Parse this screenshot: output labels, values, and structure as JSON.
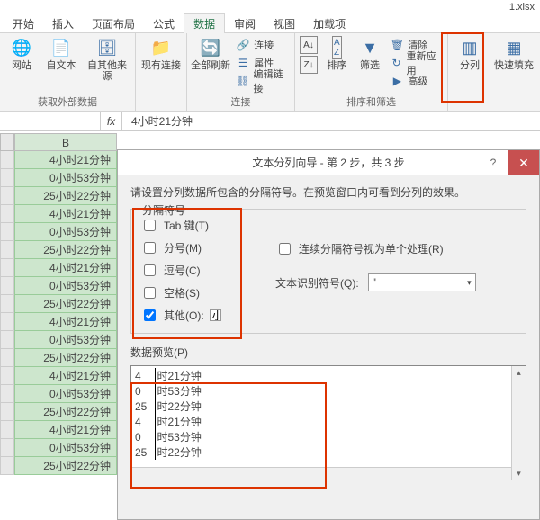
{
  "file_name": "1.xlsx",
  "tabs": {
    "t0": "开始",
    "t1": "插入",
    "t2": "页面布局",
    "t3": "公式",
    "t4": "数据",
    "t5": "审阅",
    "t6": "视图",
    "t7": "加载项"
  },
  "ribbon": {
    "ext_data_group": "获取外部数据",
    "web": "网站",
    "text": "自文本",
    "other": "自其他来源",
    "existing": "现有连接",
    "refresh": "全部刷新",
    "connections": "连接",
    "properties": "属性",
    "editlinks": "编辑链接",
    "conn_group": "连接",
    "sort": "排序",
    "filter": "筛选",
    "clear": "清除",
    "reapply": "重新应用",
    "advanced": "高级",
    "sort_group": "排序和筛选",
    "texttocol": "分列",
    "flashfill": "快速填充"
  },
  "formula_bar": {
    "fx": "fx",
    "value": "4小时21分钟"
  },
  "column_header": "B",
  "cells": [
    "4小时21分钟",
    "0小时53分钟",
    "25小时22分钟",
    "4小时21分钟",
    "0小时53分钟",
    "25小时22分钟",
    "4小时21分钟",
    "0小时53分钟",
    "25小时22分钟",
    "4小时21分钟",
    "0小时53分钟",
    "25小时22分钟",
    "4小时21分钟",
    "0小时53分钟",
    "25小时22分钟",
    "4小时21分钟",
    "0小时53分钟",
    "25小时22分钟"
  ],
  "dialog": {
    "title": "文本分列向导 - 第 2 步，共 3 步",
    "desc": "请设置分列数据所包含的分隔符号。在预览窗口内可看到分列的效果。",
    "legend": "分隔符号",
    "tab": "Tab 键(T)",
    "semicolon": "分号(M)",
    "comma": "逗号(C)",
    "space": "空格(S)",
    "other": "其他(O):",
    "other_val": "小",
    "consecutive": "连续分隔符号视为单个处理(R)",
    "qualifier_label": "文本识别符号(Q):",
    "qualifier_val": "\"",
    "preview_label": "数据预览(P)",
    "preview_rows": [
      [
        "4",
        "时21分钟"
      ],
      [
        "0",
        "时53分钟"
      ],
      [
        "25",
        "时22分钟"
      ],
      [
        "4",
        "时21分钟"
      ],
      [
        "0",
        "时53分钟"
      ],
      [
        "25",
        "时22分钟"
      ]
    ]
  }
}
